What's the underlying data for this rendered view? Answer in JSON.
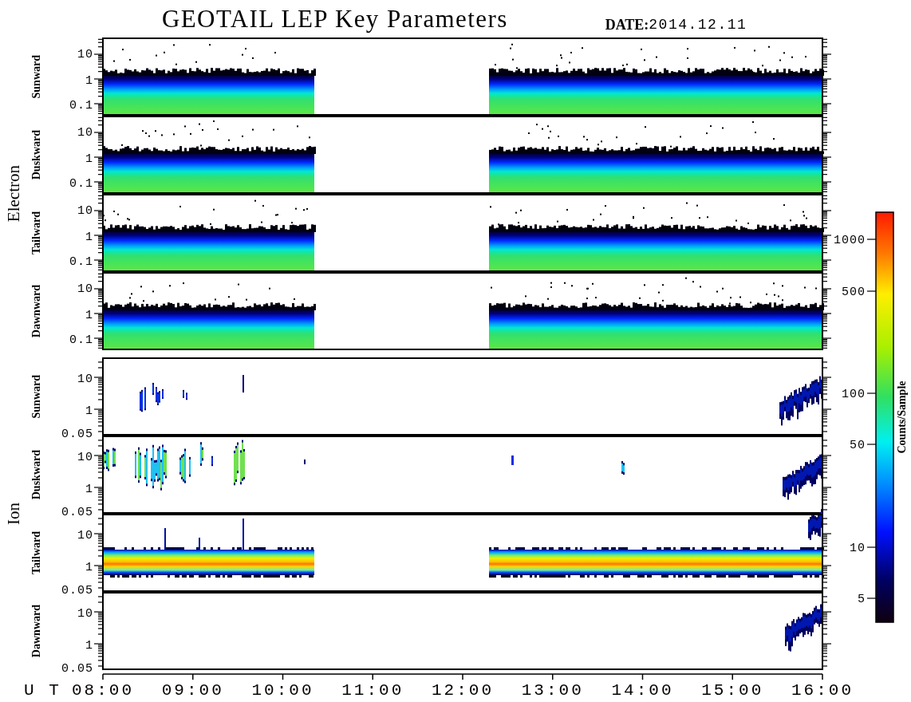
{
  "title": "GEOTAIL LEP Key Parameters",
  "date": {
    "label": "DATE:",
    "value": "2014.12.11"
  },
  "groups": [
    {
      "label": "Electron",
      "kind": "electron",
      "panels": [
        {
          "label": "Sunward",
          "kind": "electron",
          "yticks": [
            "10",
            "1",
            "0.1"
          ]
        },
        {
          "label": "Duskward",
          "kind": "electron",
          "yticks": [
            "10",
            "1",
            "0.1"
          ]
        },
        {
          "label": "Tailward",
          "kind": "electron",
          "yticks": [
            "10",
            "1",
            "0.1"
          ]
        },
        {
          "label": "Dawnward",
          "kind": "electron",
          "yticks": [
            "10",
            "1",
            "0.1"
          ]
        }
      ]
    },
    {
      "label": "Ion",
      "kind": "ion",
      "panels": [
        {
          "label": "Sunward",
          "kind": "sparse-bursts",
          "yticks": [
            "10",
            "1",
            "0.05"
          ]
        },
        {
          "label": "Duskward",
          "kind": "dense-bursts",
          "yticks": [
            "10",
            "1",
            "0.05"
          ]
        },
        {
          "label": "Tailward",
          "kind": "band",
          "yticks": [
            "10",
            "1",
            "0.05"
          ]
        },
        {
          "label": "Dawnward",
          "kind": "edge",
          "yticks": [
            "10",
            "1",
            "0.05"
          ]
        }
      ]
    }
  ],
  "time_axis": {
    "label": "U T",
    "ticks": [
      "08:00",
      "09:00",
      "10:00",
      "11:00",
      "12:00",
      "13:00",
      "14:00",
      "15:00",
      "16:00"
    ]
  },
  "colorbar": {
    "title": "Counts/Sample",
    "ticks": [
      "1000",
      "500",
      "100",
      "50",
      "10",
      "5"
    ]
  }
}
